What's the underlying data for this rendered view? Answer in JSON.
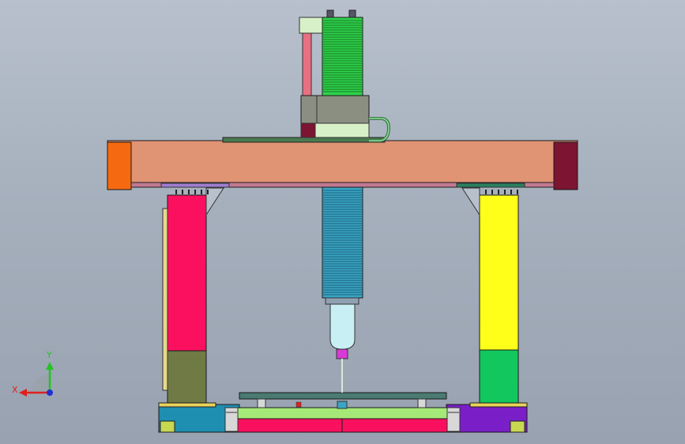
{
  "axes_triad": {
    "x_label": "X",
    "y_label": "Y",
    "x_color": "#e02020",
    "y_color": "#22c422",
    "origin_color": "#2030d0"
  },
  "colors": {
    "background_top": "#b7c0cc",
    "background_bottom": "#98a2b0",
    "beam": "#e09474",
    "beam_left_cap": "#f56a10",
    "beam_right_cap": "#7c1432",
    "left_column": "#fb1060",
    "left_column_base": "#6f7a45",
    "right_column": "#ffff1a",
    "right_column_base": "#12c85e",
    "z_axis_upper": "#2fd24a",
    "z_axis_lower": "#3aa5c4",
    "carriage": "#8a8f82",
    "carriage_plate": "#d8f0c8",
    "cable_track": "#e87080",
    "spindle": "#c8f0f4",
    "tool_holder": "#d83ad8",
    "base_left": "#1e8fb0",
    "base_right": "#7a1fc8",
    "base_center_bar": "#fb1060",
    "table_top": "#a6e878",
    "work_plate": "#4a7a70"
  }
}
